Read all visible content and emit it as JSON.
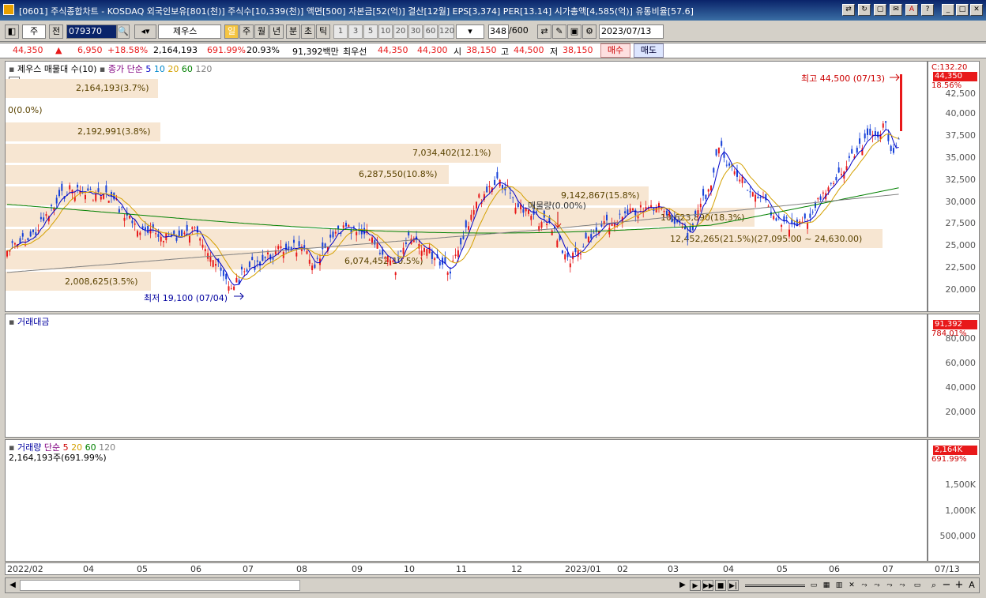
{
  "titlebar": {
    "text": "[0601] 주식종합차트 - KOSDAQ 외국인보유[801(천)] 주식수[10,339(천)] 액면[500] 자본금[52(억)] 결산[12월] EPS[3,374] PER[13.14] 시가총액[4,585(억)] 유통비율[57.6]"
  },
  "toolbar": {
    "market": "주",
    "prefix": "전",
    "code": "079370",
    "stock_name": "제우스",
    "period_buttons": [
      "일",
      "주",
      "월",
      "년",
      "분",
      "초",
      "틱"
    ],
    "interval_buttons": [
      "1",
      "3",
      "5",
      "10",
      "20",
      "30",
      "60",
      "120"
    ],
    "count": "348",
    "count_total": "/600",
    "date": "2023/07/13"
  },
  "quote": {
    "price": "44,350",
    "change": "6,950",
    "change_pct": "+18.58%",
    "volume": "2,164,193",
    "vol_pct": "691.99%",
    "turnover": "20.93%",
    "amount": "91,392백만",
    "best_ask_label": "최우선",
    "best_ask": "44,350",
    "best_bid": "44,300",
    "open_label": "시",
    "open": "38,150",
    "high_label": "고",
    "high": "44,500",
    "low_label": "저",
    "low": "38,150",
    "buy_label": "매수",
    "sell_label": "매도"
  },
  "price_panel": {
    "title": "제우스 매물대 수(10)",
    "ma_label": "종가 단순",
    "ma_periods": [
      "5",
      "10",
      "20",
      "60",
      "120"
    ],
    "c_label": "C:132.20",
    "last_price": "44,350",
    "last_pct": "18.56%",
    "y_ticks": [
      "42,500",
      "40,000",
      "37,500",
      "35,000",
      "32,500",
      "30,000",
      "27,500",
      "25,000",
      "22,500",
      "20,000"
    ],
    "high_note": "최고 44,500 (07/13)",
    "low_note": "최저 19,100 (07/04)",
    "zero_label": "0(0.0%)",
    "signal_label": "매물량(0.00%)",
    "range_label": "12,452,265(21.5%)(27,095.00 ~ 24,630.00)"
  },
  "bands": [
    {
      "label": "2,164,193(3.7%)"
    },
    {
      "label": "2,192,991(3.8%)"
    },
    {
      "label": "7,034,402(12.1%)"
    },
    {
      "label": "6,287,550(10.8%)"
    },
    {
      "label": "9,142,867(15.8%)"
    },
    {
      "label": "10,623,890(18.3%)"
    },
    {
      "label": "6,074,452(10.5%)"
    },
    {
      "label": "2,008,625(3.5%)"
    }
  ],
  "amount_panel": {
    "title": "거래대금",
    "last_value": "91,392",
    "last_pct": "784.01%",
    "y_ticks": [
      "80,000",
      "60,000",
      "40,000",
      "20,000"
    ]
  },
  "volume_panel": {
    "title": "거래량",
    "ma_label": "단순",
    "ma_periods": [
      "5",
      "20",
      "60",
      "120"
    ],
    "value_line": "2,164,193주(691.99%)",
    "last_value": "2,164K",
    "last_pct": "691.99%",
    "y_ticks": [
      "1,500K",
      "1,000K",
      "500,000"
    ]
  },
  "x_labels": [
    "2022/02",
    "04",
    "05",
    "06",
    "07",
    "08",
    "09",
    "10",
    "11",
    "12",
    "2023/01",
    "02",
    "03",
    "04",
    "05",
    "06",
    "07",
    "07/13"
  ],
  "colors": {
    "up": "#e8191a",
    "down": "#1640d8",
    "band": "#f7e6d2",
    "ma5": "#0000c8",
    "ma20": "#d4a000",
    "ma60": "#008000",
    "ma120": "#808080"
  }
}
